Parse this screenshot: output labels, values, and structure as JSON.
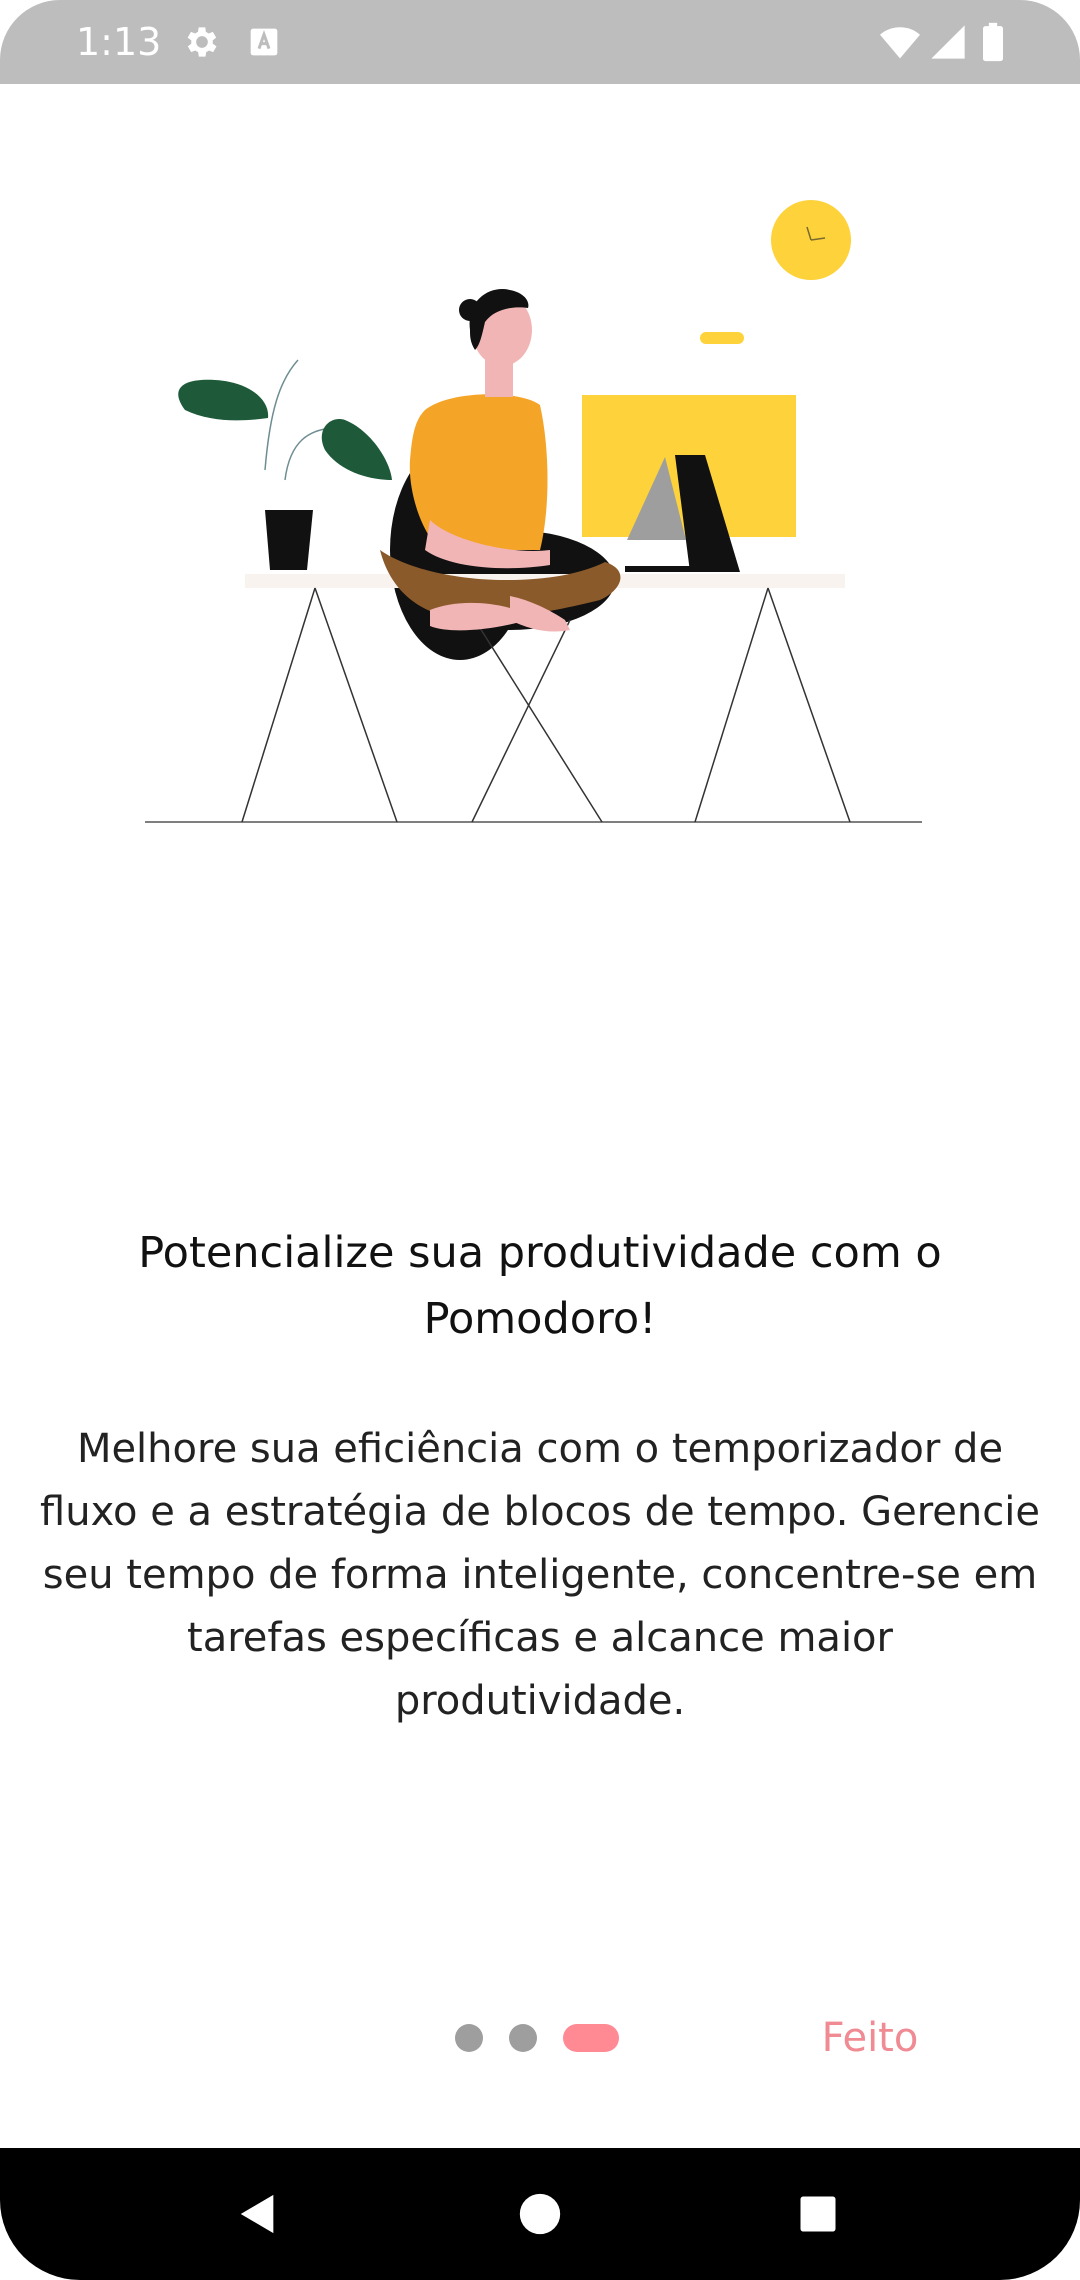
{
  "status_bar": {
    "time": "1:13",
    "left_icons": [
      "gear-icon",
      "text-icon"
    ],
    "right_icons": [
      "wifi-icon",
      "signal-icon",
      "battery-icon"
    ],
    "background": "#bdbdbd"
  },
  "onboarding": {
    "title": "Potencialize sua produtividade com o Pomodoro!",
    "description": "Melhore sua eficiência com o temporizador de fluxo e a estratégia de blocos de tempo. Gerencie seu tempo de forma inteligente, concentre-se em tarefas específicas e alcance maior produtividade.",
    "page_indicator": {
      "total": 3,
      "current": 3
    },
    "done_label": "Feito",
    "accent_color": "#f08a93"
  },
  "nav_bar": {
    "buttons": [
      "back-icon",
      "home-icon",
      "recents-icon"
    ]
  }
}
